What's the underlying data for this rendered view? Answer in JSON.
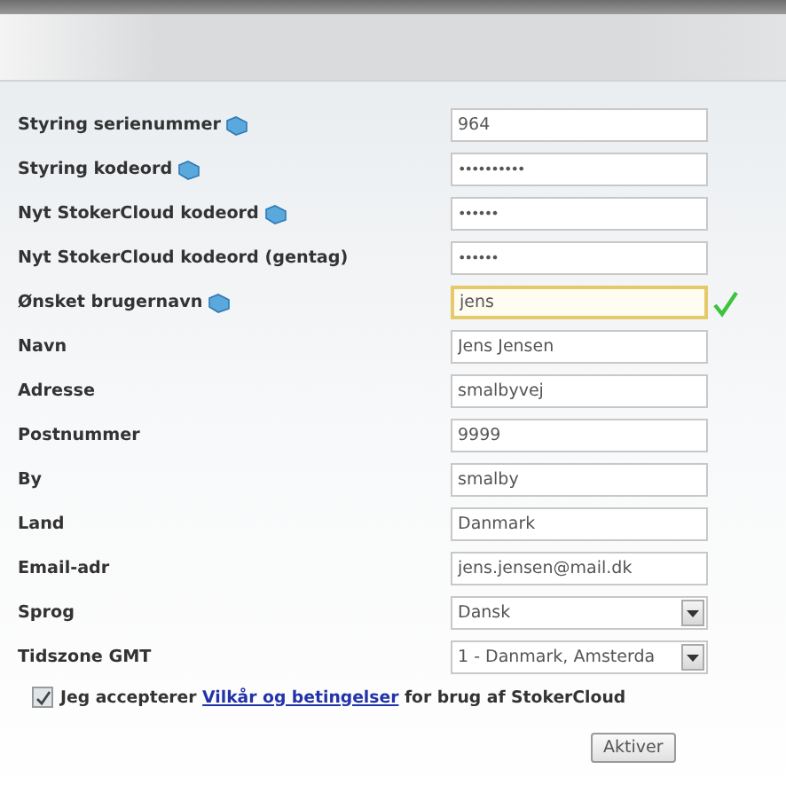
{
  "fields": [
    {
      "label": "Styring serienummer",
      "kind": "text",
      "value": "964",
      "help": true,
      "focused": false,
      "valid": false
    },
    {
      "label": "Styring kodeord",
      "kind": "password",
      "value": "••••••••••",
      "help": true,
      "focused": false,
      "valid": false
    },
    {
      "label": "Nyt StokerCloud kodeord",
      "kind": "password",
      "value": "••••••",
      "help": true,
      "focused": false,
      "valid": false
    },
    {
      "label": "Nyt StokerCloud kodeord (gentag)",
      "kind": "password",
      "value": "••••••",
      "help": false,
      "focused": false,
      "valid": false
    },
    {
      "label": "Ønsket brugernavn",
      "kind": "text",
      "value": "jens",
      "help": true,
      "focused": true,
      "valid": true
    },
    {
      "label": "Navn",
      "kind": "text",
      "value": "Jens Jensen",
      "help": false,
      "focused": false,
      "valid": false
    },
    {
      "label": "Adresse",
      "kind": "text",
      "value": "smalbyvej",
      "help": false,
      "focused": false,
      "valid": false
    },
    {
      "label": "Postnummer",
      "kind": "text",
      "value": "9999",
      "help": false,
      "focused": false,
      "valid": false
    },
    {
      "label": "By",
      "kind": "text",
      "value": "smalby",
      "help": false,
      "focused": false,
      "valid": false
    },
    {
      "label": "Land",
      "kind": "text",
      "value": "Danmark",
      "help": false,
      "focused": false,
      "valid": false
    },
    {
      "label": "Email-adr",
      "kind": "text",
      "value": "jens.jensen@mail.dk",
      "help": false,
      "focused": false,
      "valid": false
    },
    {
      "label": "Sprog",
      "kind": "select",
      "value": "Dansk",
      "help": false,
      "focused": false,
      "valid": false
    },
    {
      "label": "Tidszone GMT",
      "kind": "select",
      "value": "1 - Danmark, Amsterda",
      "help": false,
      "focused": false,
      "valid": false
    }
  ],
  "terms": {
    "checked": true,
    "before": "Jeg accepterer",
    "link": "Vilkår og betingelser",
    "after": "for brug af StokerCloud"
  },
  "submit": "Aktiver"
}
